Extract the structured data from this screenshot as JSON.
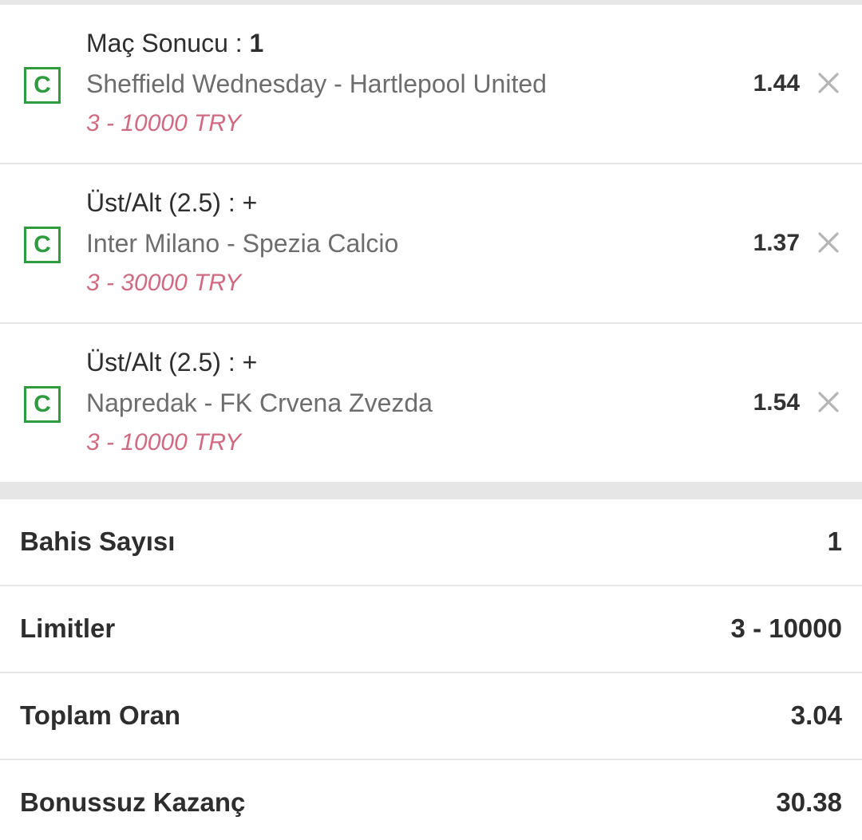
{
  "bets": [
    {
      "badge": "C",
      "market": "Maç Sonucu : ",
      "selection": "1",
      "match": "Sheffield Wednesday - Hartlepool United",
      "limit": "3 - 10000 TRY",
      "odd": "1.44"
    },
    {
      "badge": "C",
      "market": "Üst/Alt (2.5) : ",
      "selection": "+",
      "match": "Inter Milano - Spezia Calcio",
      "limit": "3 - 30000 TRY",
      "odd": "1.37"
    },
    {
      "badge": "C",
      "market": "Üst/Alt (2.5) : ",
      "selection": "+",
      "match": "Napredak - FK Crvena Zvezda",
      "limit": "3 - 10000 TRY",
      "odd": "1.54"
    }
  ],
  "summary": {
    "bet_count_label": "Bahis Sayısı",
    "bet_count_value": "1",
    "limits_label": "Limitler",
    "limits_value": "3 - 10000",
    "total_odds_label": "Toplam Oran",
    "total_odds_value": "3.04",
    "winnings_label": "Bonussuz Kazanç",
    "winnings_value": "30.38"
  },
  "colors": {
    "badge": "#2e9b3e",
    "limit_text": "#d06a80",
    "divider": "#e6e6e6"
  },
  "icons": {
    "remove": "close-icon",
    "badge": "c-badge-icon"
  }
}
